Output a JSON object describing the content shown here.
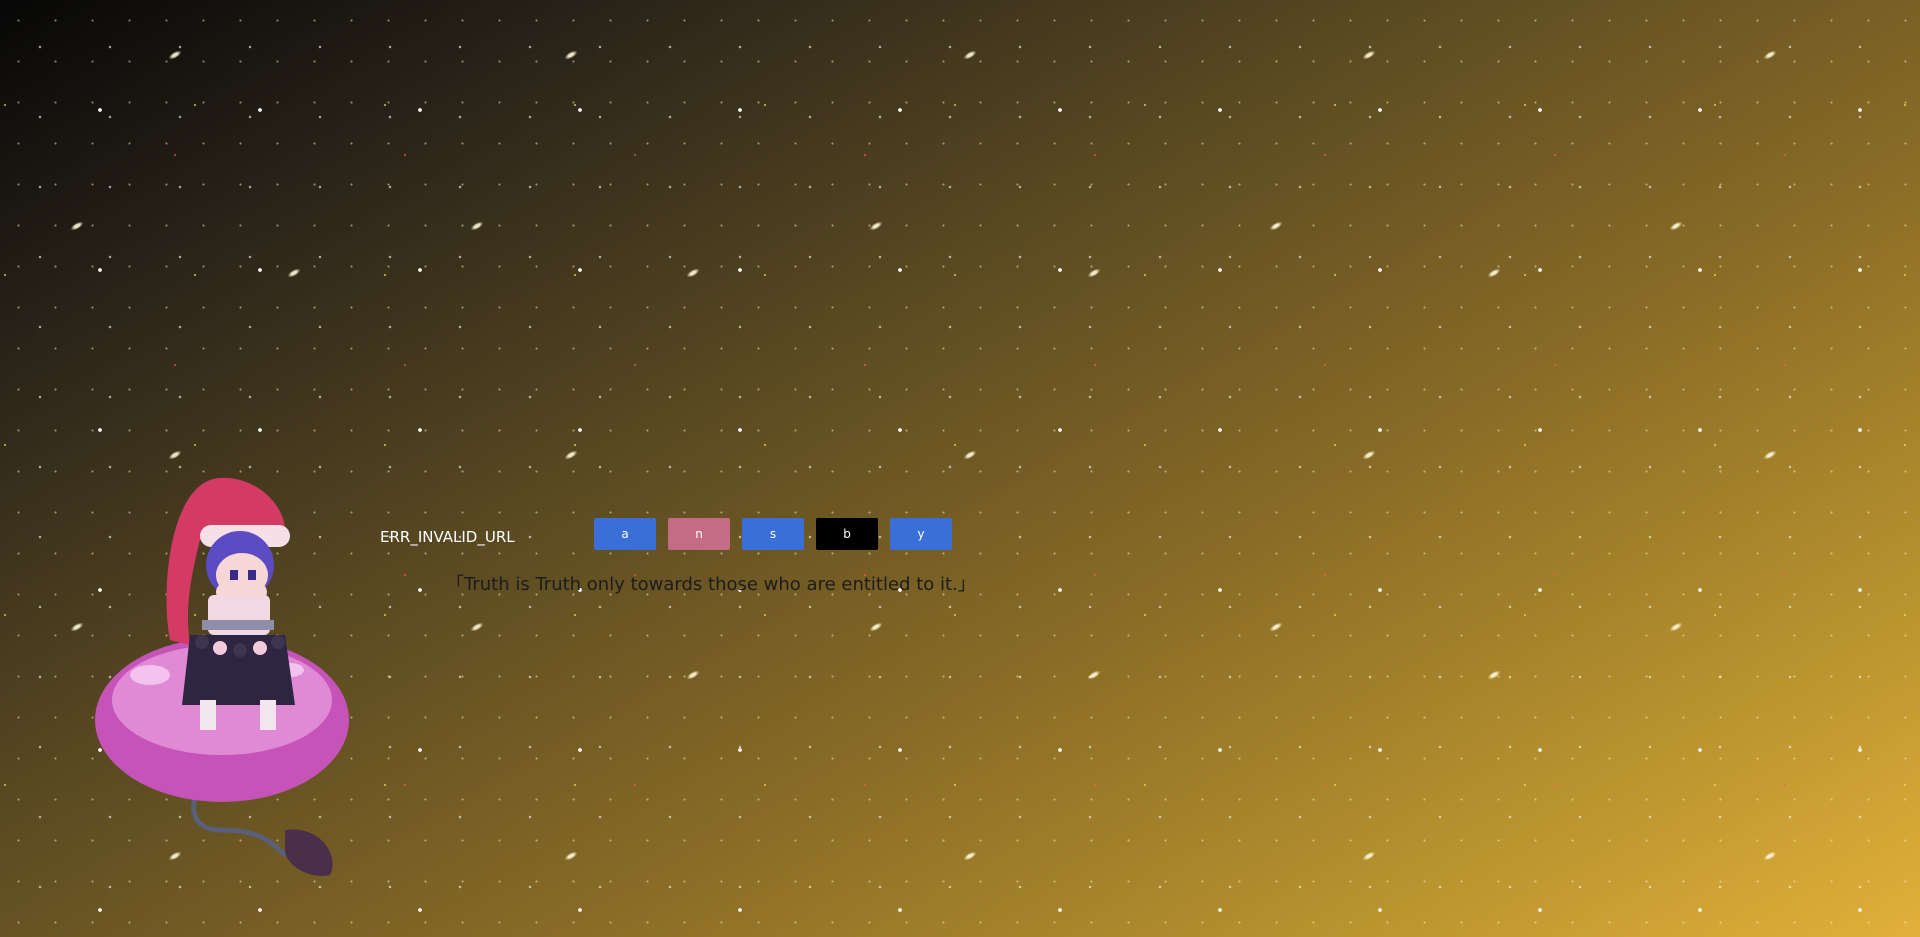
{
  "error": {
    "code": "ERR_INVALID_URL"
  },
  "buttons": [
    {
      "label": "a",
      "color": "#3a6fd8"
    },
    {
      "label": "n",
      "color": "#c46b86"
    },
    {
      "label": "s",
      "color": "#3a6fd8"
    },
    {
      "label": "b",
      "color": "#000000"
    },
    {
      "label": "y",
      "color": "#3a6fd8"
    }
  ],
  "quote": {
    "text": "「Truth is Truth only towards those who are entitled to it.」"
  },
  "background": {
    "gradient_start": "#070707",
    "gradient_end": "#e2b03a"
  },
  "illustration": {
    "icon": "character-sprite"
  }
}
